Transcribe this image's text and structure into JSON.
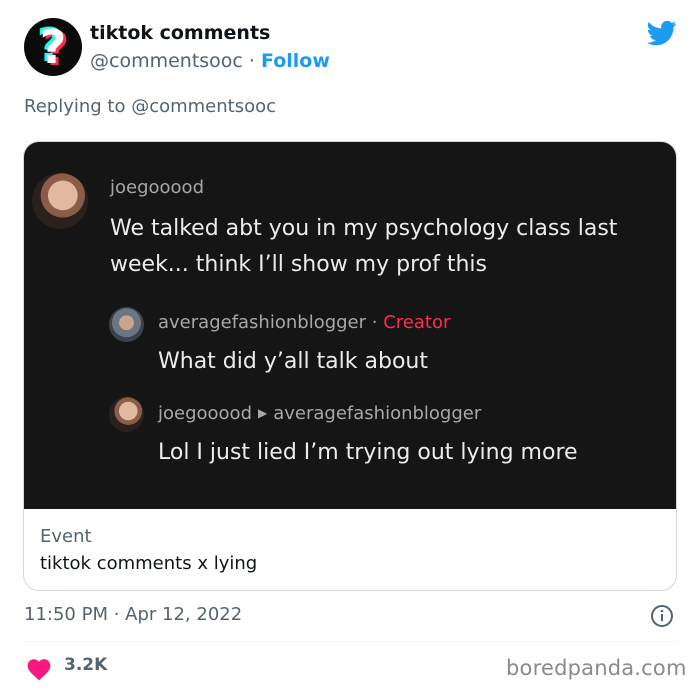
{
  "author": {
    "avatar_glyph": "?",
    "name": "tiktok comments",
    "handle": "@commentsooc",
    "separator": " · ",
    "follow_label": "Follow"
  },
  "reply": {
    "prefix": "Replying to ",
    "handle": "@commentsooc"
  },
  "media": {
    "comments": [
      {
        "username": "joegooood",
        "text_line1": "We talked abt you in my psychology class last",
        "text_line2": "week... think I’ll show my prof this"
      },
      {
        "username": "averagefashionblogger",
        "separator": " · ",
        "badge": "Creator",
        "text": "What did y’all talk about"
      },
      {
        "username": "joegooood",
        "arrow": "▶",
        "reply_to": "averagefashionblogger",
        "text": "Lol I just lied I’m trying out lying more"
      }
    ]
  },
  "card": {
    "label": "Event",
    "title": "tiktok comments x lying"
  },
  "timestamp": {
    "time": "11:50 PM",
    "separator": " · ",
    "date": "Apr 12, 2022"
  },
  "likes": {
    "count": "3.2K"
  },
  "watermark": "boredpanda.com",
  "colors": {
    "twitter_blue": "#1d9bf0",
    "heart_pink": "#f91880",
    "tiktok_red": "#fe2c55",
    "tiktok_cyan": "#25f4ee"
  },
  "icons": [
    "twitter-bird-icon",
    "info-icon",
    "heart-icon"
  ]
}
